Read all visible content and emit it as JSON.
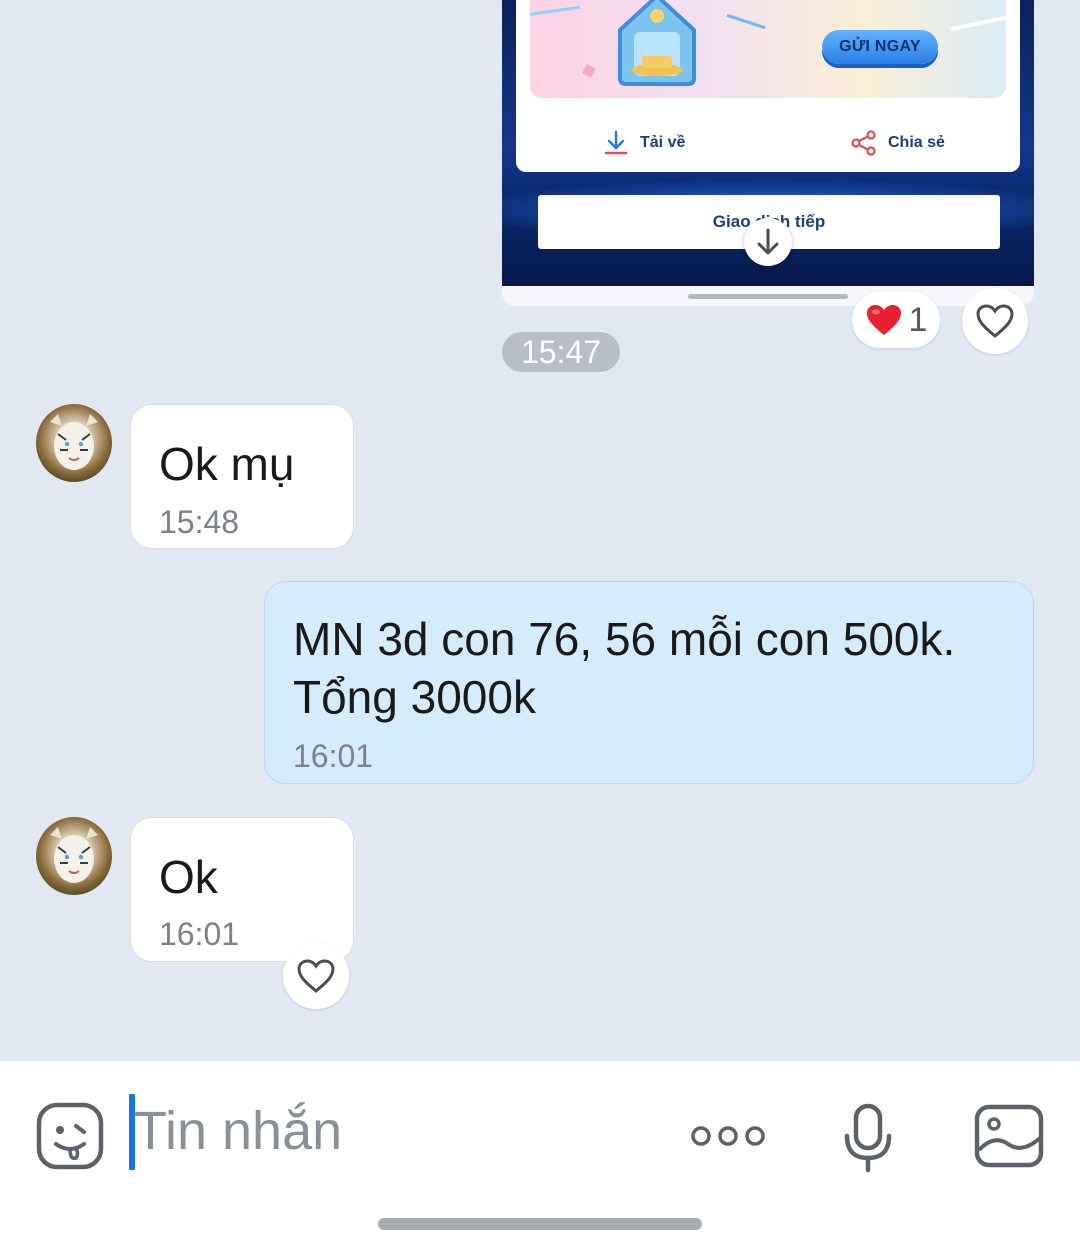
{
  "shared_card": {
    "send_button_label": "GỬI NGAY",
    "download_label": "Tải về",
    "share_label": "Chia sẻ",
    "continue_label": "Giao dịch tiếp"
  },
  "card_reaction": {
    "emoji": "❤️",
    "count": "1"
  },
  "timestamp_divider": "15:47",
  "messages": [
    {
      "direction": "incoming",
      "text": "Ok mụ",
      "time": "15:48"
    },
    {
      "direction": "outgoing",
      "text_line1": "MN 3d con 76, 56 mỗi con 500k.",
      "text_line2": "Tổng 3000k",
      "time": "16:01"
    },
    {
      "direction": "incoming",
      "text": "Ok",
      "time": "16:01"
    }
  ],
  "composer": {
    "placeholder": "Tin nhắn",
    "icons": [
      "emoji-icon",
      "more-icon",
      "microphone-icon",
      "image-icon"
    ]
  },
  "colors": {
    "background": "#e2e8f1",
    "outgoing_bubble": "#d5ecfd",
    "incoming_bubble": "#ffffff",
    "caret": "#1a73e8",
    "heart": "#e8202f"
  }
}
